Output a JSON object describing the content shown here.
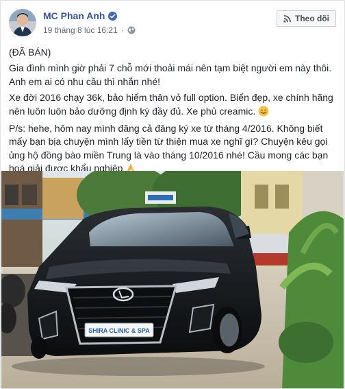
{
  "post": {
    "author": "MC Phan Anh",
    "timestamp": "19 tháng 8 lúc 16:21",
    "privacy_icon": "globe-icon",
    "follow_label": "Theo dõi",
    "paragraphs": [
      "(ĐÃ BÁN)",
      "Gia đình mình giờ phải 7 chỗ mới thoải mái nên tạm biệt người em này thôi. Anh em ai có nhu cầu thì nhắn nhé!",
      "Xe đời 2016 chạy 36k, bảo hiểm thân vỏ full option. Biển đẹp, xe chính hãng nên luôn luôn bảo dưỡng định kỳ đầy đủ. Xe phủ creamic.",
      "P/s: hehe, hôm nay mình đăng cả đăng ký xe từ tháng 4/2016. Không biết mấy bạn bịa chuyện mình lấy tiền từ thiện mua xe nghĩ gì? Chuyện kêu gọi ủng hộ đồng bào miền Trung là vào tháng 10/2016 nhé! Cầu mong các bạn hoá giải được khẩu nghiệp"
    ],
    "photo": {
      "plate_text": "SHIRA CLINIC & SPA"
    }
  },
  "colors": {
    "link": "#365899",
    "text": "#1d2129",
    "muted": "#616770"
  }
}
